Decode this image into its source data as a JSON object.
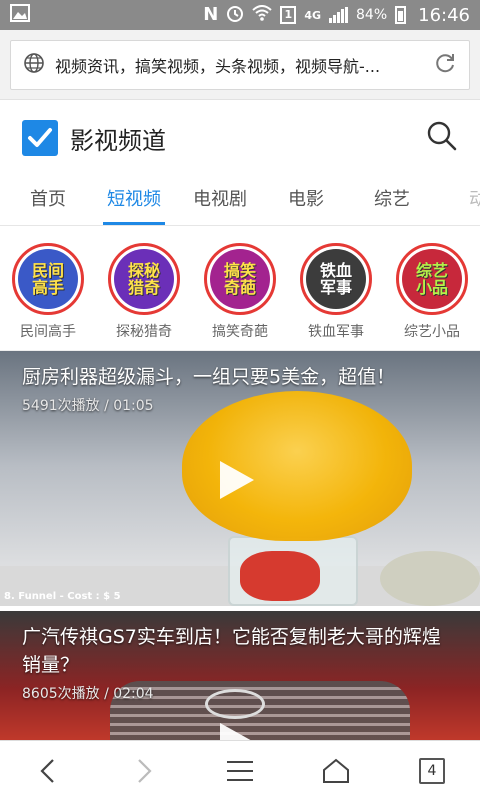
{
  "status_bar": {
    "network": "4G",
    "sim": "1",
    "battery": "84%",
    "time": "16:46"
  },
  "url_bar": {
    "text": "视频资讯，搞笑视频，头条视频，视频导航-..."
  },
  "header": {
    "title": "影视频道"
  },
  "tabs": [
    {
      "label": "首页"
    },
    {
      "label": "短视频"
    },
    {
      "label": "电视剧"
    },
    {
      "label": "电影"
    },
    {
      "label": "综艺"
    },
    {
      "label": "动"
    }
  ],
  "channels": [
    {
      "label": "民间高手",
      "art": "民间\n高手",
      "color": "#3a59c7"
    },
    {
      "label": "探秘猎奇",
      "art": "探秘\n猎奇",
      "color": "#6b2fb8"
    },
    {
      "label": "搞笑奇葩",
      "art": "搞笑\n奇葩",
      "color": "#a3238f"
    },
    {
      "label": "铁血军事",
      "art": "铁血\n军事",
      "color": "#3c3c3c"
    },
    {
      "label": "综艺小品",
      "art": "综艺\n小品",
      "color": "#c7283b"
    }
  ],
  "videos": [
    {
      "title": "厨房利器超级漏斗，一组只要5美金，超值！",
      "meta": "5491次播放 / 01:05",
      "caption": "8. Funnel - Cost : $ 5"
    },
    {
      "title": "广汽传祺GS7实车到店！它能否复制老大哥的辉煌销量？",
      "meta": "8605次播放 / 02:04"
    }
  ],
  "bottom_nav": {
    "tab_count": "4"
  },
  "colors": {
    "accent": "#1e88e5",
    "channel_ring": "#e53935"
  }
}
